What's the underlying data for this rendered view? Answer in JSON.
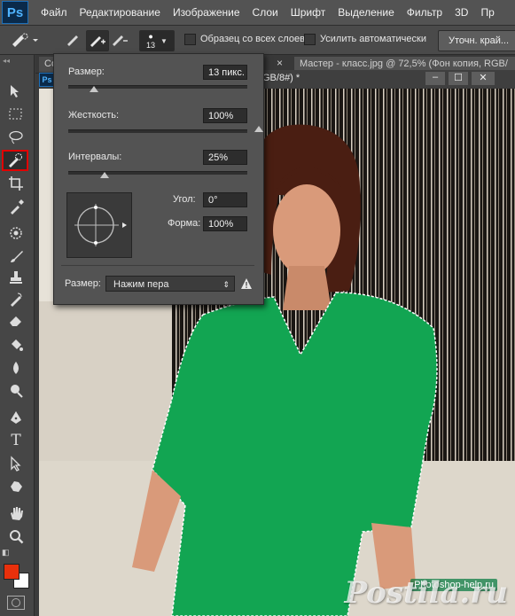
{
  "menubar": {
    "logo": "Ps",
    "items": [
      "Файл",
      "Редактирование",
      "Изображение",
      "Слои",
      "Шрифт",
      "Выделение",
      "Фильтр",
      "3D",
      "Пр"
    ]
  },
  "options": {
    "brush_size_value": "13",
    "sample_all_layers_label": "Образец со всех слоев",
    "auto_enhance_label": "Усилить автоматически",
    "refine_edge_label": "Уточн. край..."
  },
  "documents": {
    "tab_left_partial": "Co",
    "tab_close": "×",
    "active_title": "Мастер - класс.jpg @ 72,5% (Фон копия, RGB/",
    "inner_tab_partial": "Ps",
    "title_fragment": "GB/8#) *",
    "win_buttons": [
      "–",
      "☐",
      "✕"
    ]
  },
  "brush_panel": {
    "size_label": "Размер:",
    "size_value": "13 пикс.",
    "hardness_label": "Жесткость:",
    "hardness_value": "100%",
    "spacing_label": "Интервалы:",
    "spacing_value": "25%",
    "angle_label": "Угол:",
    "angle_value": "0°",
    "roundness_label": "Форма:",
    "roundness_value": "100%",
    "pen_size_label": "Размер:",
    "pen_size_option": "Нажим пера",
    "warning_icon": "warning-icon"
  },
  "watermark": {
    "main": "Postila.ru",
    "small": "Photoshop-help.ru"
  },
  "colors": {
    "foreground": "#e8300c",
    "background": "#ffffff",
    "active_tool_border": "#e00000"
  }
}
